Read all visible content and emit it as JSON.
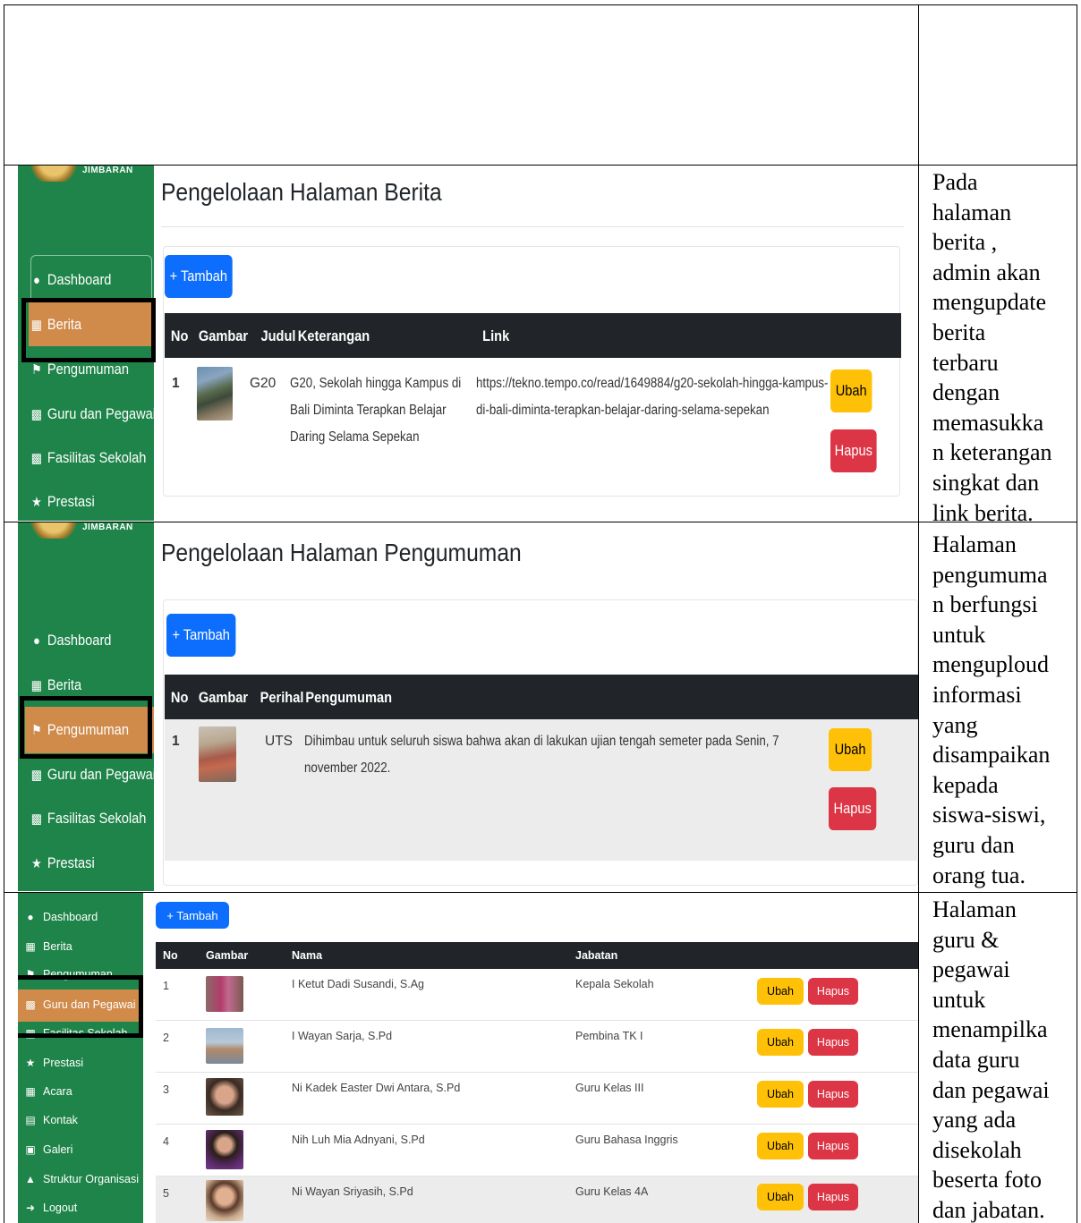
{
  "rows": [
    {
      "description": "Pada halaman berita , admin akan mengupdate berita terbaru dengan memasukkan keterangan singkat dan link berita.",
      "desc_lines": [
        "Pada",
        "halaman",
        "berita ,",
        "admin akan",
        "mengupdate",
        "berita",
        "terbaru",
        "dengan",
        "memasukka",
        "n keterangan",
        "singkat dan",
        "link berita."
      ],
      "logo_text": "JIMBARAN",
      "nav": [
        "Dashboard",
        "Berita",
        "Pengumuman",
        "Guru dan Pegawai",
        "Fasilitas Sekolah",
        "Prestasi"
      ],
      "title": "Pengelolaan Halaman Berita",
      "add_label": "+ Tambah",
      "headers": [
        "No",
        "Gambar",
        "Judul",
        "Keterangan",
        "Link"
      ],
      "item": {
        "no": "1",
        "judul": "G20",
        "keterangan": [
          "G20, Sekolah hingga Kampus di",
          "Bali Diminta Terapkan Belajar",
          "Daring Selama Sepekan"
        ],
        "link": [
          "https://tekno.tempo.co/read/1649884/g20-sekolah-hingga-kampus-",
          "di-bali-diminta-terapkan-belajar-daring-selama-sepekan"
        ],
        "edit": "Ubah",
        "delete": "Hapus"
      }
    },
    {
      "description": "Halaman pengumuman berfungsi untuk menguploud informasi yang disampaikan kepada siswa-siswi, guru dan orang tua.",
      "desc_lines": [
        "Halaman",
        "pengumuma",
        "n berfungsi",
        "untuk",
        "menguploud",
        "informasi",
        "yang",
        "disampaikan",
        "kepada",
        "siswa-siswi,",
        "guru dan",
        "orang tua."
      ],
      "logo_text": "JIMBARAN",
      "nav": [
        "Dashboard",
        "Berita",
        "Pengumuman",
        "Guru dan Pegawai",
        "Fasilitas Sekolah",
        "Prestasi"
      ],
      "title": "Pengelolaan Halaman Pengumuman",
      "add_label": "+ Tambah",
      "headers": [
        "No",
        "Gambar",
        "Perihal",
        "Pengumuman"
      ],
      "item": {
        "no": "1",
        "perihal": "UTS",
        "pengumuman": [
          "Dihimbau untuk seluruh siswa bahwa akan di lakukan ujian tengah semeter pada Senin, 7",
          "november 2022."
        ],
        "edit": "Ubah",
        "delete": "Hapus"
      }
    },
    {
      "description": "Halaman guru & pegawai untuk menampilkan data guru dan pegawai yang ada disekolah beserta foto dan jabatan.",
      "desc_lines": [
        "Halaman",
        "guru &",
        "pegawai",
        "untuk",
        "menampilka",
        "data guru",
        "dan pegawai",
        "yang ada",
        "disekolah",
        "beserta foto",
        "dan jabatan."
      ],
      "nav": [
        "Dashboard",
        "Berita",
        "Pengumuman",
        "Guru dan Pegawai",
        "Fasilitas Sekolah",
        "Prestasi",
        "Acara",
        "Kontak",
        "Galeri",
        "Struktur Organisasi",
        "Logout"
      ],
      "add_label": "+ Tambah",
      "headers": [
        "No",
        "Gambar",
        "Nama",
        "Jabatan"
      ],
      "items": [
        {
          "no": "1",
          "nama": "I Ketut Dadi Susandi, S.Ag",
          "jabatan": "Kepala Sekolah"
        },
        {
          "no": "2",
          "nama": "I Wayan Sarja, S.Pd",
          "jabatan": "Pembina TK I"
        },
        {
          "no": "3",
          "nama": "Ni Kadek Easter Dwi Antara, S.Pd",
          "jabatan": "Guru Kelas III"
        },
        {
          "no": "4",
          "nama": "Nih Luh Mia Adnyani, S.Pd",
          "jabatan": "Guru Bahasa Inggris"
        },
        {
          "no": "5",
          "nama": "Ni Wayan Sriyasih, S.Pd",
          "jabatan": "Guru Kelas 4A"
        }
      ],
      "edit": "Ubah",
      "delete": "Hapus"
    }
  ]
}
